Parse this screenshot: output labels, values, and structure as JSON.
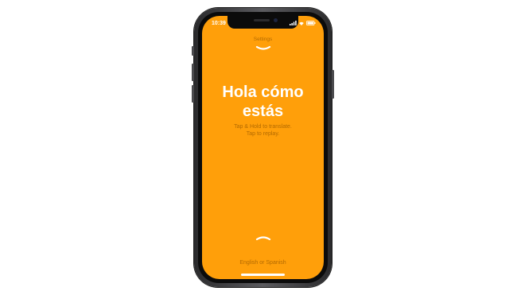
{
  "status_bar": {
    "time": "10:39",
    "icons": [
      "signal-icon",
      "wifi-icon",
      "battery-icon"
    ]
  },
  "header": {
    "settings_label": "Settings",
    "chevron_icon": "chevron-down-icon"
  },
  "main": {
    "phrase_line1": "Hola cómo",
    "phrase_line2": "estás",
    "hint_line1": "Tap & Hold to translate.",
    "hint_line2": "Tap to replay."
  },
  "footer": {
    "chevron_icon": "chevron-up-icon",
    "language_label": "English or Spanish"
  },
  "colors": {
    "background": "#ff9f0a",
    "accent_text": "#b36a00",
    "primary_text": "#ffffff",
    "device_frame": "#2a2a2c"
  }
}
